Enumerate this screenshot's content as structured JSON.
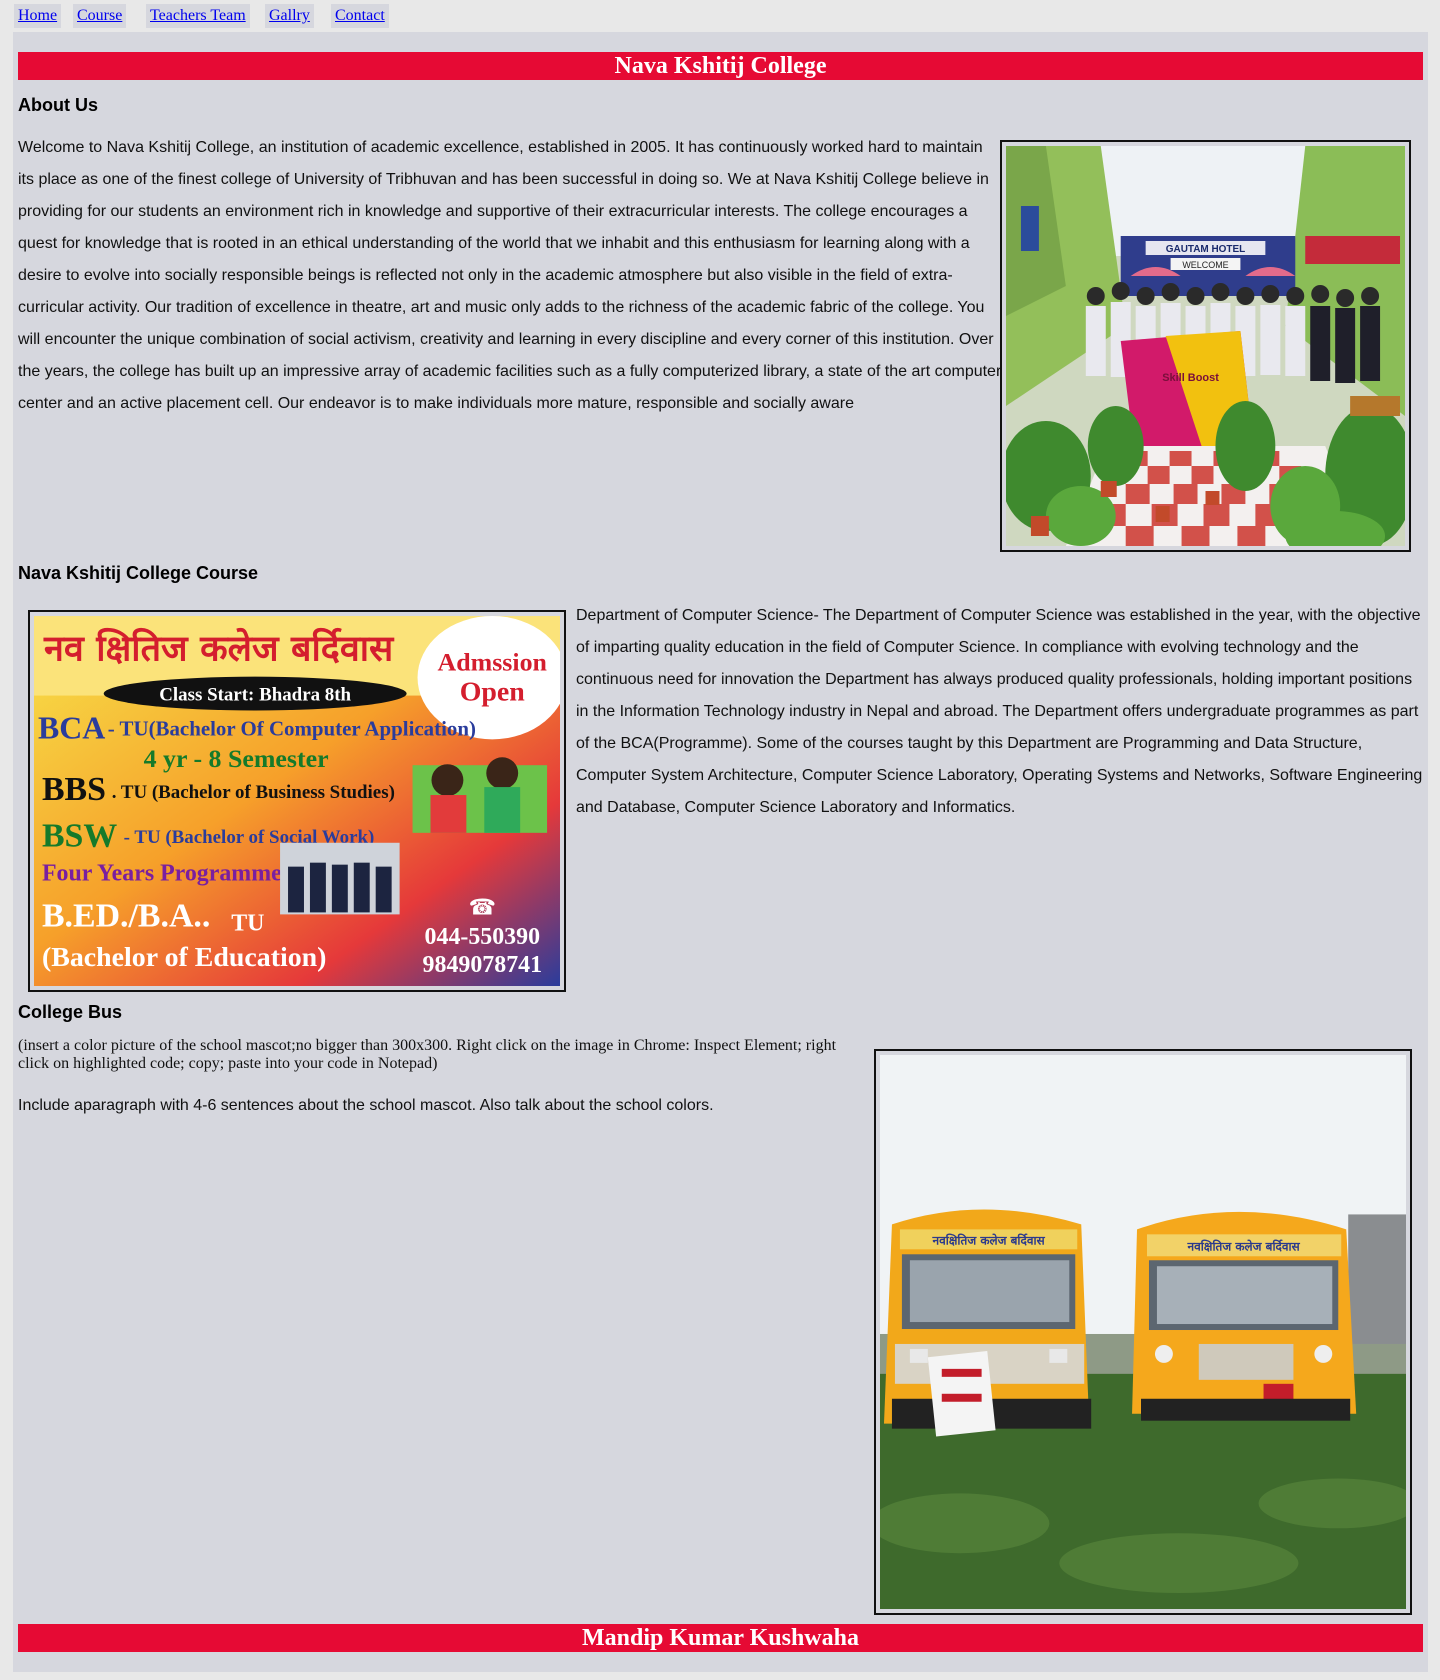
{
  "nav": {
    "items": [
      {
        "label": "Home"
      },
      {
        "label": "Course"
      },
      {
        "label": "Teachers Team"
      },
      {
        "label": "Gallry"
      },
      {
        "label": "Contact"
      }
    ]
  },
  "header": {
    "title": "Nava Kshitij College"
  },
  "about": {
    "heading": "About Us",
    "text": "Welcome to Nava Kshitij College, an institution of academic excellence, established in 2005. It has continuously worked hard to maintain its place as one of the finest college of University of Tribhuvan and has been successful in doing so. We at Nava Kshitij College believe in providing for our students an environment rich in knowledge and supportive of their extracurricular interests. The college encourages a quest for knowledge that is rooted in an ethical understanding of the world that we inhabit and this enthusiasm for learning along with a desire to evolve into socially responsible beings is reflected not only in the academic atmosphere but also visible in the field of extra-curricular activity. Our tradition of excellence in theatre, art and music only adds to the richness of the academic fabric of the college. You will encounter the unique combination of social activism, creativity and learning in every discipline and every corner of this institution. Over the years, the college has built up an impressive array of academic facilities such as a fully computerized library, a state of the art computer center and an active placement cell. Our endeavor is to make individuals more mature, responsible and socially aware",
    "photo": {
      "hotel_sign": "GAUTAM HOTEL",
      "welcome_sign": "WELCOME",
      "banner_text": "Skill Boost"
    }
  },
  "course": {
    "heading": "Nava Kshitij College Course",
    "text": "Department of Computer Science- The Department of Computer Science was established in the year, with the objective of imparting quality education in the field of Computer Science. In compliance with evolving technology and the continuous need for innovation the Department has always produced quality professionals, holding important positions in the Information Technology industry in Nepal and abroad. The Department offers undergraduate programmes as part of the BCA(Programme). Some of the courses taught by this Department are Programming and Data Structure, Computer System Architecture, Computer Science Laboratory, Operating Systems and Networks, Software Engineering and Database, Computer Science Laboratory and Informatics.",
    "poster": {
      "title": "नव क्षितिज कलेज बर्दिवास",
      "admission": [
        "Admssion",
        "Open"
      ],
      "class_start": "Class Start: Bhadra 8th",
      "bca": "BCA",
      "bca_desc": "- TU(Bachelor Of Computer Application)",
      "duration": "4 yr - 8 Semester",
      "bbs": "BBS",
      "bbs_desc": ". TU (Bachelor of Business Studies)",
      "bsw": "BSW",
      "bsw_desc": "- TU  (Bachelor of Social Work)",
      "four_years": "Four Years Programme",
      "bed": "B.ED./B.A..",
      "bed_tu": "TU",
      "bed_desc": "(Bachelor of Education)",
      "phone_icon": "telephone-icon",
      "phone1": "044-550390",
      "phone2": "9849078741"
    }
  },
  "bus": {
    "heading": "College Bus",
    "note": "(insert a color picture of the school mascot;no bigger than 300x300. Right click on the image in Chrome: Inspect Element; right click on highlighted code; copy; paste into your code in Notepad)",
    "text": "Include aparagraph with 4-6 sentences about the school mascot. Also talk about the school colors.",
    "photo": {
      "bus_sign": "नवक्षितिज कलेज बर्दिवास"
    }
  },
  "footer": {
    "name": "Mandip Kumar Kushwaha"
  },
  "colors": {
    "accent": "#e60a34",
    "background": "#d6d7de",
    "link": "#0000ee"
  }
}
